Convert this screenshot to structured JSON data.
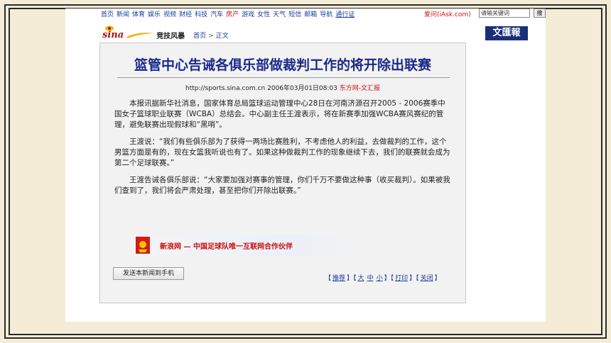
{
  "nav": {
    "items": [
      {
        "label": "首页",
        "red": false,
        "underline": false
      },
      {
        "label": "新闻",
        "red": false,
        "underline": false
      },
      {
        "label": "体育",
        "red": false,
        "underline": false
      },
      {
        "label": "娱乐",
        "red": false,
        "underline": false
      },
      {
        "label": "视频",
        "red": false,
        "underline": false
      },
      {
        "label": "财经",
        "red": false,
        "underline": false
      },
      {
        "label": "科技",
        "red": false,
        "underline": false
      },
      {
        "label": "汽车",
        "red": false,
        "underline": false
      },
      {
        "label": "房产",
        "red": true,
        "underline": false
      },
      {
        "label": "游戏",
        "red": false,
        "underline": false
      },
      {
        "label": "女性",
        "red": false,
        "underline": false
      },
      {
        "label": "天气",
        "red": false,
        "underline": false
      },
      {
        "label": "短信",
        "red": false,
        "underline": false
      },
      {
        "label": "邮箱",
        "red": false,
        "underline": false
      },
      {
        "label": "导航",
        "red": false,
        "underline": false
      },
      {
        "label": "通行证",
        "red": false,
        "underline": true
      }
    ],
    "iask": "爱问(iAsk.com)",
    "search_value": "请输关键词",
    "search_button": "搜"
  },
  "header": {
    "logo": "sina",
    "section": "竞技风暴",
    "breadcrumb_home": "首页",
    "breadcrumb_sep": ">",
    "breadcrumb_current": "正文",
    "newspaper_logo": "文匯報"
  },
  "article": {
    "title": "篮管中心告诫各俱乐部做裁判工作的将开除出联赛",
    "url": "http://sports.sina.com.cn",
    "date": "2006年03月01日08:03",
    "source": "东方网-文汇报",
    "paragraphs": [
      "本报讯据新华社消息，国家体育总局篮球运动管理中心28日在河南济源召开2005 - 2006赛季中国女子篮球职业联赛（WCBA）总结会。中心副主任王渡表示，将在新赛季加强WCBA赛风赛纪的管理，避免联赛出现假球和“黑哨”。",
      "王渡说：“我们有些俱乐部为了获得一两场比赛胜利，不考虑他人的利益，去做裁判的工作，这个男篮方面是有的，现在女篮我听说也有了。如果这种做裁判工作的现象继续下去，我们的联赛就会成为第二个足球联赛。”",
      "王渡告诫各俱乐部说：“大家要加强对赛事的管理，你们千万不要做这种事（收买裁判）。如果被我们查到了，我们将会严肃处理，甚至把你们开除出联赛。”"
    ]
  },
  "banner": {
    "text": "新浪网 — 中国足球队唯一互联网合作伙伴"
  },
  "footer": {
    "send_button": "发送本新闻到手机",
    "tools_open": "【",
    "recommend": "推荐",
    "size_large": "大",
    "size_medium": "中",
    "size_small": "小",
    "print": "打印",
    "close": "关闭"
  },
  "colors": {
    "background": "#f4ecd6",
    "link": "#1a3a9a",
    "headline": "#1a2a8a",
    "accent_red": "#cc1111",
    "newspaper_logo_bg": "#1b2f78"
  }
}
